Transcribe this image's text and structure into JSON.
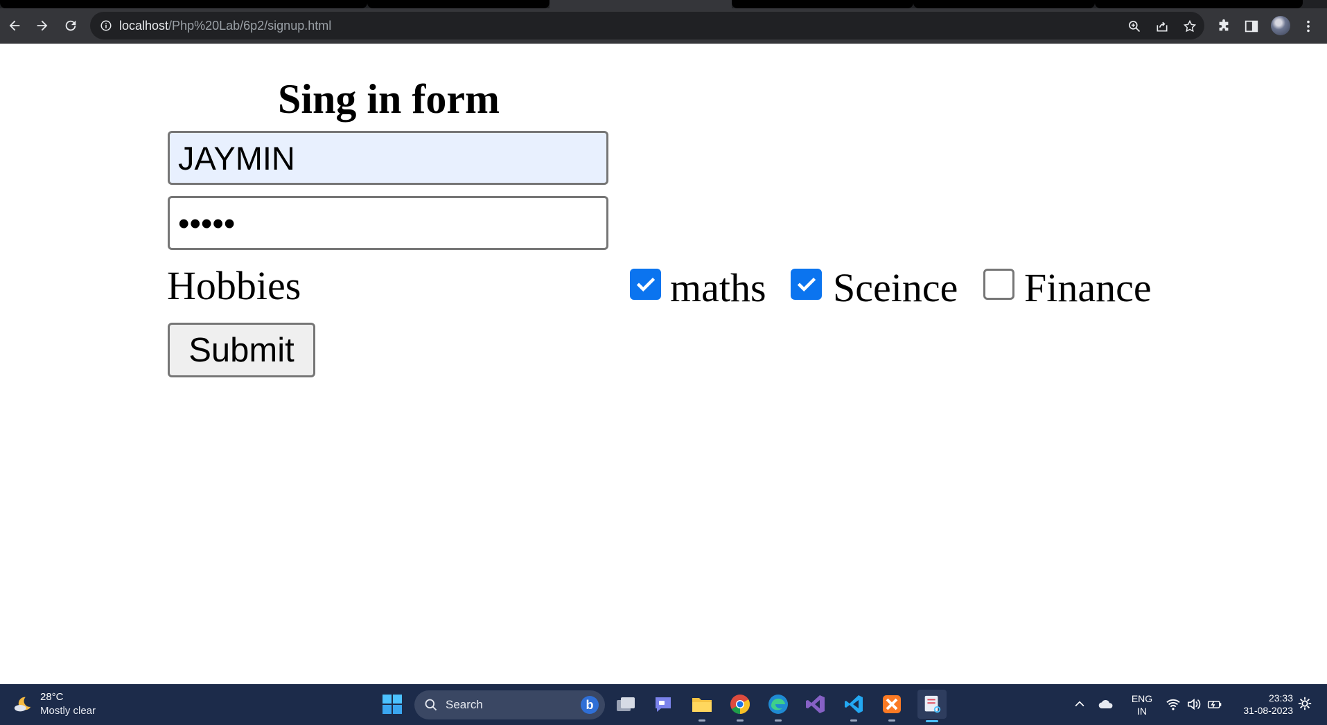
{
  "browser": {
    "url_host": "localhost",
    "url_path": "/Php%20Lab/6p2/signup.html"
  },
  "form": {
    "title": "Sing in form",
    "username_value": "JAYMIN",
    "password_value": "•••••",
    "hobbies_label": "Hobbies",
    "hobbies": [
      {
        "label": "maths",
        "checked": true
      },
      {
        "label": "Sceince",
        "checked": true
      },
      {
        "label": "Finance",
        "checked": false
      }
    ],
    "submit_label": "Submit"
  },
  "taskbar": {
    "weather_temp": "28°C",
    "weather_desc": "Mostly clear",
    "search_label": "Search",
    "lang_line1": "ENG",
    "lang_line2": "IN",
    "time": "23:33",
    "date": "31-08-2023"
  },
  "colors": {
    "checkbox_accent": "#0b74ef",
    "autofill_bg": "#e8f0fe",
    "taskbar_bg": "#1c2b4a",
    "chrome_bg": "#35363a"
  }
}
